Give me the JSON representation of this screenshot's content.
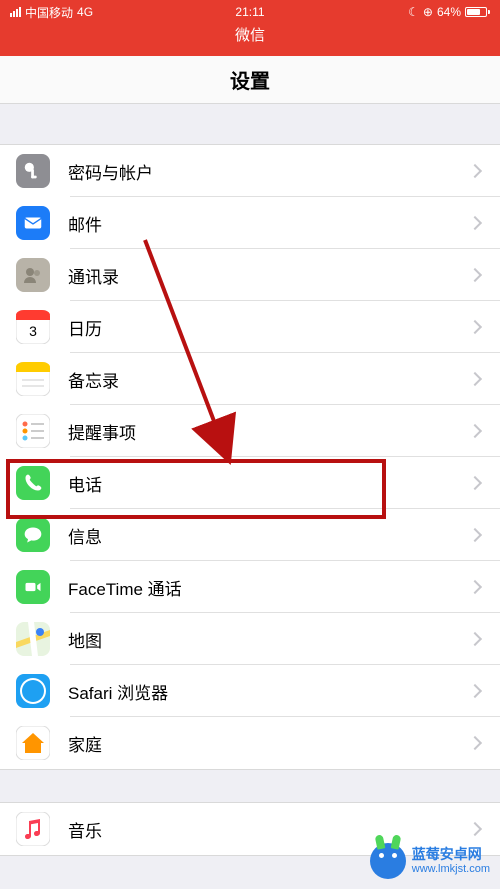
{
  "statusBar": {
    "carrier": "中国移动",
    "network": "4G",
    "time": "21:11",
    "batteryPct": "64%"
  },
  "navTitle": "微信",
  "pageTitle": "设置",
  "sections": [
    {
      "rows": [
        {
          "id": "passwords",
          "label": "密码与帐户",
          "icon": "key",
          "bg": "#8e8e93"
        },
        {
          "id": "mail",
          "label": "邮件",
          "icon": "mail",
          "bg": "#1c7cf8"
        },
        {
          "id": "contacts",
          "label": "通讯录",
          "icon": "contacts",
          "bg": "#b8b3a8"
        },
        {
          "id": "calendar",
          "label": "日历",
          "icon": "calendar",
          "bg": "#ffffff"
        },
        {
          "id": "notes",
          "label": "备忘录",
          "icon": "notes",
          "bg": "#ffffff"
        },
        {
          "id": "reminders",
          "label": "提醒事项",
          "icon": "reminders",
          "bg": "#ffffff"
        },
        {
          "id": "phone",
          "label": "电话",
          "icon": "phone",
          "bg": "#43d459"
        },
        {
          "id": "messages",
          "label": "信息",
          "icon": "messages",
          "bg": "#43d459"
        },
        {
          "id": "facetime",
          "label": "FaceTime 通话",
          "icon": "facetime",
          "bg": "#43d459"
        },
        {
          "id": "maps",
          "label": "地图",
          "icon": "maps",
          "bg": "#ffffff"
        },
        {
          "id": "safari",
          "label": "Safari 浏览器",
          "icon": "safari",
          "bg": "#1ea0f2"
        },
        {
          "id": "home",
          "label": "家庭",
          "icon": "home",
          "bg": "#ffffff"
        }
      ]
    },
    {
      "rows": [
        {
          "id": "music",
          "label": "音乐",
          "icon": "music",
          "bg": "#ffffff"
        }
      ]
    }
  ],
  "watermark": {
    "title": "蓝莓安卓网",
    "url": "www.lmkjst.com"
  }
}
